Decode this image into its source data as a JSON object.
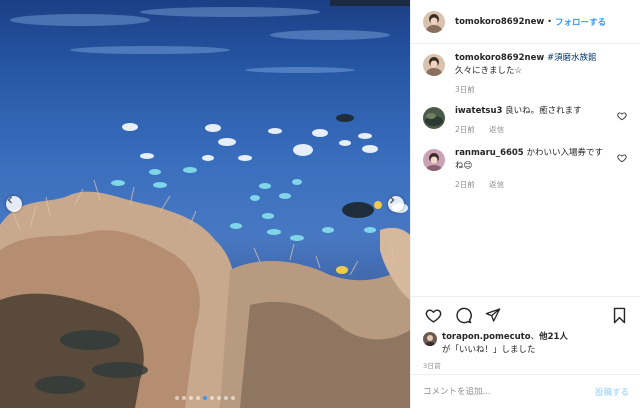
{
  "post": {
    "author": "tomokoro8692new",
    "separator": "•",
    "follow_label": "フォローする",
    "caption": {
      "username": "tomokoro8692new",
      "hashtag": "#須磨水族館",
      "text": "久々にきました☆",
      "time": "3日前"
    },
    "comments": [
      {
        "username": "iwatetsu3",
        "text": "良いね。癒されます",
        "time": "2日前",
        "reply_label": "返信"
      },
      {
        "username": "ranmaru_6605",
        "text": "かわいい入場券ですね😊",
        "time": "2日前",
        "reply_label": "返信"
      }
    ],
    "likes": {
      "names": "torapon.pomecuto",
      "connector": "、",
      "others": "他21人",
      "suffix": "が「いいね！」しました"
    },
    "timestamp": "3日前",
    "comment_placeholder": "コメントを追加...",
    "post_label": "投稿する"
  },
  "carousel": {
    "slide_count": 9,
    "active_index": 4
  },
  "colors": {
    "accent": "#3897f0",
    "post_disabled": "#b2dffc",
    "meta": "#8e8e8e"
  },
  "icons": [
    "heart-icon",
    "comment-icon",
    "share-icon",
    "bookmark-icon",
    "chevron-left-icon",
    "chevron-right-icon"
  ]
}
